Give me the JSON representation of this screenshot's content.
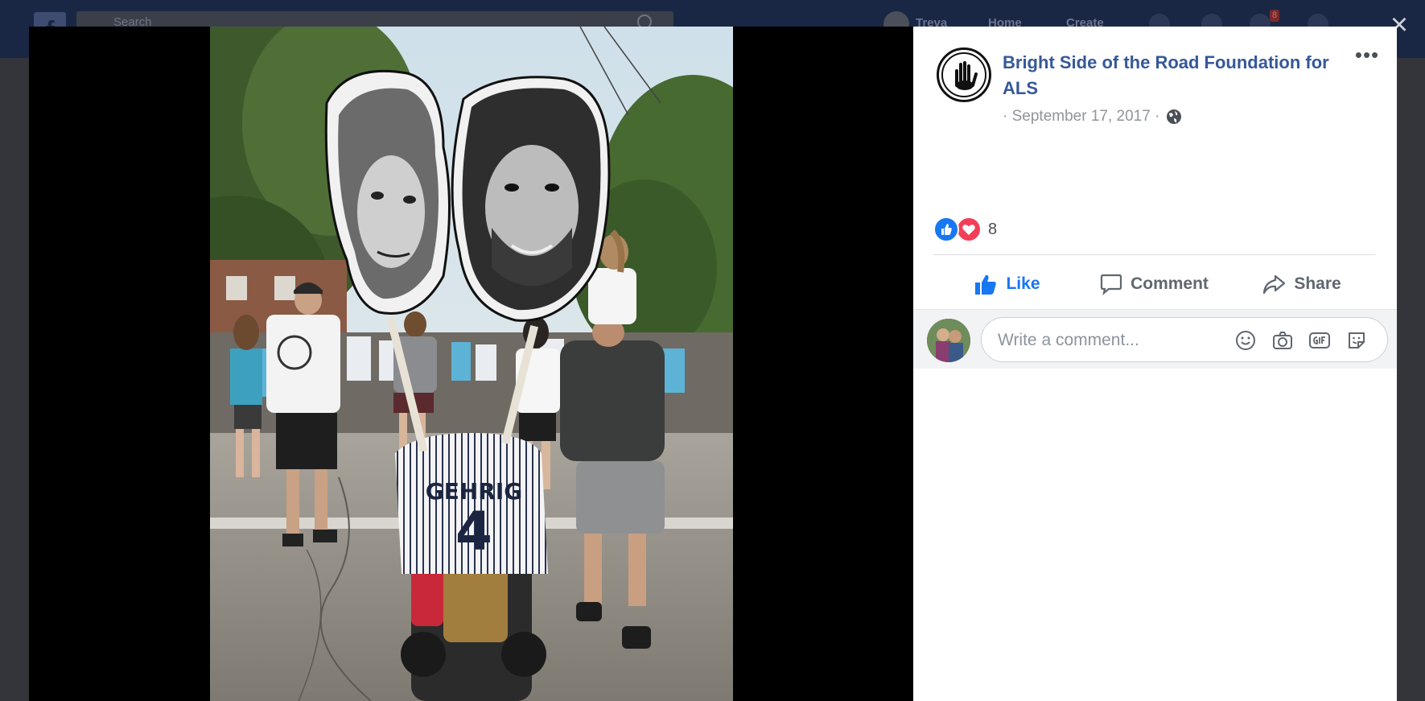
{
  "fb": {
    "logo": "f",
    "search_placeholder": "Search",
    "nav_items": [
      "Treva",
      "Home",
      "Create"
    ],
    "notification_count": "8"
  },
  "viewer": {
    "close_label": "×",
    "photo_alt": "People walking at a charity event; a wheelchair with a GEHRIG 4 pinstriped jersey and two large face cutouts on sticks",
    "jersey_name": "GEHRIG",
    "jersey_number": "4"
  },
  "post": {
    "page_name": "Bright Side of the Road Foundation for ALS",
    "more_label": "•••",
    "date": "· September 17, 2017 ·",
    "reaction_count": "8",
    "actions": {
      "like": "Like",
      "comment": "Comment",
      "share": "Share"
    },
    "comment_placeholder": "Write a comment..."
  },
  "colors": {
    "link_blue": "#365899",
    "like_blue": "#1877f2",
    "love_red": "#f33e58",
    "viewer_bg": "#000000",
    "panel_bg": "#ffffff"
  },
  "icons": {
    "globe": "globe-icon",
    "like": "thumbs-up-icon",
    "comment": "speech-bubble-icon",
    "share": "share-arrow-icon",
    "emoji": "smiley-icon",
    "camera": "camera-icon",
    "gif": "gif-icon",
    "sticker": "sticker-icon"
  }
}
